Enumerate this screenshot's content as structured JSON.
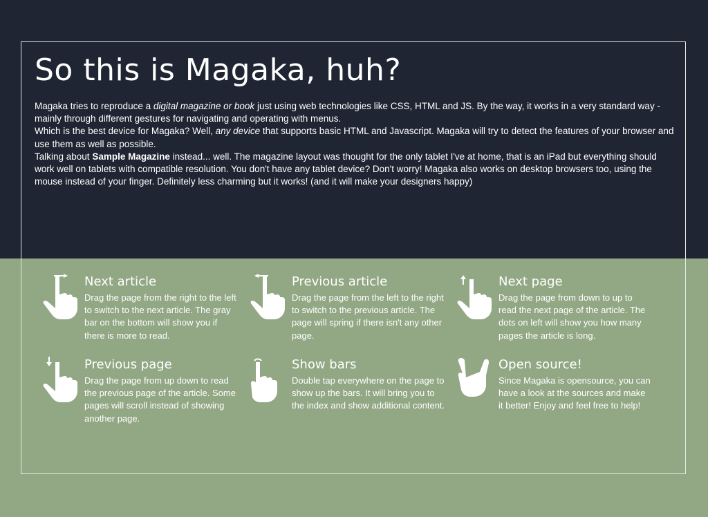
{
  "header": {
    "title": "So this is Magaka, huh?"
  },
  "intro": {
    "p1": {
      "a": "Magaka tries to reproduce a ",
      "em": "digital magazine or book",
      "b": " just using web technologies like CSS, HTML and JS. By the way, it works in a very standard way - mainly through different gestures for navigating and operating with menus."
    },
    "p2": {
      "a": "Which is the best device for Magaka? Well, ",
      "em": "any device",
      "b": " that supports basic HTML and Javascript. Magaka will try to detect the features of your browser and use them as well as possible."
    },
    "p3": {
      "a": "Talking about ",
      "strong": "Sample Magazine",
      "b": " instead... well. The magazine layout was thought for the only tablet I've at home, that is an iPad but everything should work well on tablets with compatible resolution. You don't have any tablet device? Don't worry! Magaka also works on desktop browsers too, using the mouse instead of your finger. Definitely less charming but it works! (and it will make your designers happy)"
    }
  },
  "features": [
    {
      "icon": "swipe-left-hand-icon",
      "title": "Next article",
      "text": "Drag the page from the right to the left to switch to the next article. The gray bar on the bottom will show you if there is more to read."
    },
    {
      "icon": "swipe-right-hand-icon",
      "title": "Previous article",
      "text": "Drag the page from the left to the right to switch to the previous article. The page will spring if there isn't any other page."
    },
    {
      "icon": "swipe-up-hand-icon",
      "title": "Next page",
      "text": "Drag the page from down to up to read the next page of the article. The dots on left will show you how many pages the article is long."
    },
    {
      "icon": "swipe-down-hand-icon",
      "title": "Previous page",
      "text": "Drag the page from up down to read the previous page of the article. Some pages will scroll instead of showing another page."
    },
    {
      "icon": "double-tap-hand-icon",
      "title": "Show bars",
      "text": "Double tap everywhere on the page to show up the bars. It will bring you to the index and show additional content."
    },
    {
      "icon": "rock-hand-icon",
      "title": "Open source!",
      "text": "Since Magaka is opensource, you can have a look at the sources and make it better! Enjoy and feel free to help!"
    }
  ],
  "colors": {
    "top_background": "#1f2532",
    "bottom_background": "#92a784",
    "text": "#ffffff",
    "frame_border": "#e8ece4"
  }
}
